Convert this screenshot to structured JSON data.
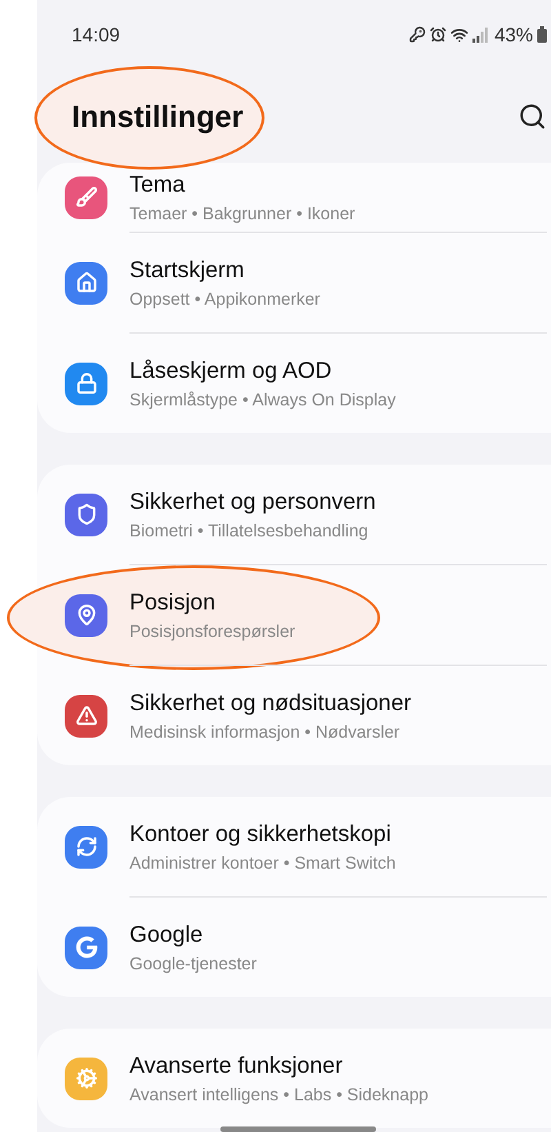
{
  "status_bar": {
    "time": "14:09",
    "battery": "43%"
  },
  "header": {
    "title": "Innstillinger",
    "highlighted": true
  },
  "groups": [
    {
      "items": [
        {
          "title": "Tema",
          "subtitle": "Temaer • Bakgrunner • Ikoner",
          "color": "#e8557c",
          "highlighted": false
        },
        {
          "title": "Startskjerm",
          "subtitle": "Oppsett • Appikonmerker",
          "color": "#3f7ef0",
          "highlighted": false
        },
        {
          "title": "Låseskjerm og AOD",
          "subtitle": "Skjermlåstype • Always On Display",
          "color": "#2189f0",
          "highlighted": false
        }
      ]
    },
    {
      "items": [
        {
          "title": "Sikkerhet og personvern",
          "subtitle": "Biometri • Tillatelsesbehandling",
          "color": "#5b67e8",
          "highlighted": false
        },
        {
          "title": "Posisjon",
          "subtitle": "Posisjonsforespørsler",
          "color": "#5b67e8",
          "highlighted": true
        },
        {
          "title": "Sikkerhet og nødsituasjoner",
          "subtitle": "Medisinsk informasjon • Nødvarsler",
          "color": "#d64444",
          "highlighted": false
        }
      ]
    },
    {
      "items": [
        {
          "title": "Kontoer og sikkerhetskopi",
          "subtitle": "Administrer kontoer • Smart Switch",
          "color": "#3f7ef0",
          "highlighted": false
        },
        {
          "title": "Google",
          "subtitle": "Google-tjenester",
          "color": "#3f7ef0",
          "highlighted": false
        }
      ]
    },
    {
      "items": [
        {
          "title": "Avanserte funksjoner",
          "subtitle": "Avansert intelligens • Labs • Sideknapp",
          "color": "#f5b63d",
          "highlighted": false
        }
      ]
    }
  ]
}
